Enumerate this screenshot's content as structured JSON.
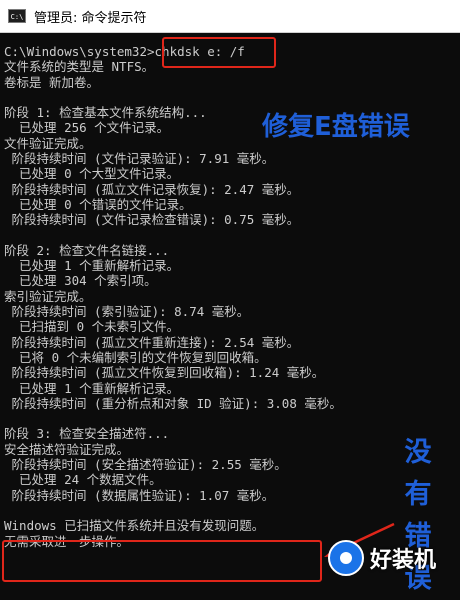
{
  "window": {
    "title": "管理员: 命令提示符",
    "icon": "cmd-icon",
    "icon_text": "C:\\"
  },
  "console_lines": [
    "C:\\Windows\\system32>chkdsk e: /f",
    "文件系统的类型是 NTFS。",
    "卷标是 新加卷。",
    "",
    "阶段 1: 检查基本文件系统结构...",
    "  已处理 256 个文件记录。",
    "文件验证完成。",
    " 阶段持续时间 (文件记录验证): 7.91 毫秒。",
    "  已处理 0 个大型文件记录。",
    " 阶段持续时间 (孤立文件记录恢复): 2.47 毫秒。",
    "  已处理 0 个错误的文件记录。",
    " 阶段持续时间 (文件记录检查错误): 0.75 毫秒。",
    "",
    "阶段 2: 检查文件名链接...",
    "  已处理 1 个重新解析记录。",
    "  已处理 304 个索引项。",
    "索引验证完成。",
    " 阶段持续时间 (索引验证): 8.74 毫秒。",
    "  已扫描到 0 个未索引文件。",
    " 阶段持续时间 (孤立文件重新连接): 2.54 毫秒。",
    "  已将 0 个未编制索引的文件恢复到回收箱。",
    " 阶段持续时间 (孤立文件恢复到回收箱): 1.24 毫秒。",
    "  已处理 1 个重新解析记录。",
    " 阶段持续时间 (重分析点和对象 ID 验证): 3.08 毫秒。",
    "",
    "阶段 3: 检查安全描述符...",
    "安全描述符验证完成。",
    " 阶段持续时间 (安全描述符验证): 2.55 毫秒。",
    "  已处理 24 个数据文件。",
    " 阶段持续时间 (数据属性验证): 1.07 毫秒。",
    "",
    "Windows 已扫描文件系统并且没有发现问题。",
    "无需采取进一步操作。"
  ],
  "annotations": {
    "fix_label": "修复E盘错误",
    "no_error_label": "没有错误"
  },
  "watermark": {
    "text": "好装机",
    "icon": "watermark-logo-icon"
  },
  "colors": {
    "annotation": "#1f5fd8",
    "highlight_box": "#e0261a",
    "console_text": "#cccccc",
    "console_bg": "#0c0c0c"
  }
}
